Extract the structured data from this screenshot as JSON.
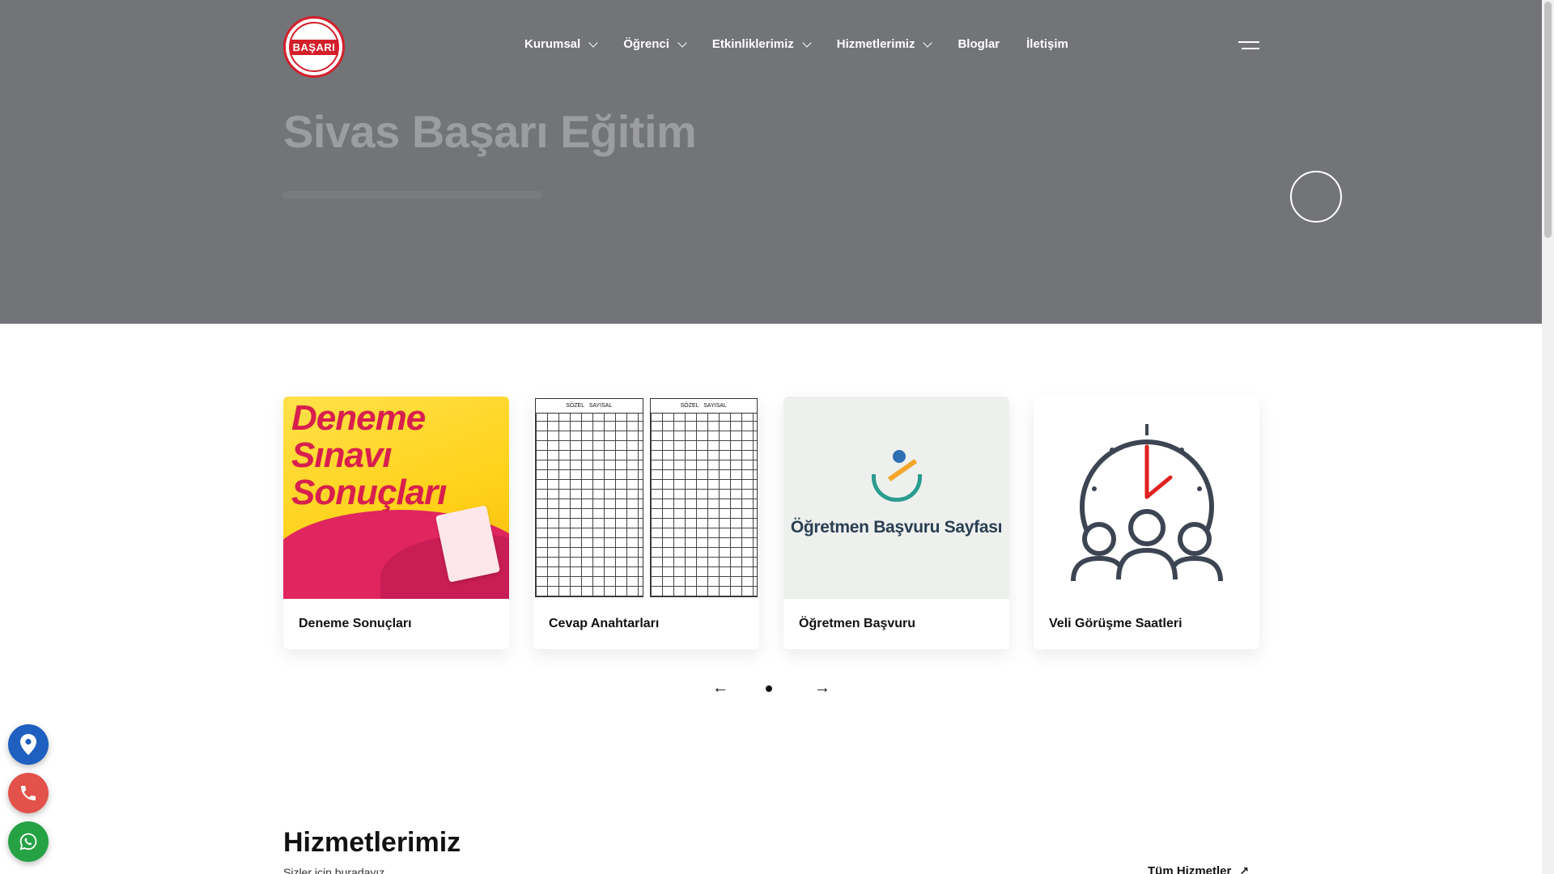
{
  "header": {
    "logo_text": "BAŞARI",
    "nav": [
      {
        "label": "Kurumsal",
        "has_dropdown": true
      },
      {
        "label": "Öğrenci",
        "has_dropdown": true
      },
      {
        "label": "Etkinliklerimiz",
        "has_dropdown": true
      },
      {
        "label": "Hizmetlerimiz",
        "has_dropdown": true
      },
      {
        "label": "Bloglar",
        "has_dropdown": false
      },
      {
        "label": "İletişim",
        "has_dropdown": false
      }
    ],
    "menu_icon": "hamburger-icon"
  },
  "hero": {
    "title": "Sivas Başarı Eğitim",
    "play_icon": "play-circle-icon"
  },
  "cards": [
    {
      "label": "Deneme Sonuçları",
      "image_text": [
        "Deneme",
        "Sınavı",
        "Sonuçları"
      ]
    },
    {
      "label": "Cevap Anahtarları",
      "image_text": [
        "SÖZEL",
        "SAYISAL"
      ]
    },
    {
      "label": "Öğretmen Başvuru",
      "image_text": [
        "Öğretmen Başvuru Sayfası"
      ]
    },
    {
      "label": "Veli Görüşme Saatleri",
      "image_text": []
    }
  ],
  "slider": {
    "prev_icon": "arrow-left-icon",
    "next_icon": "arrow-right-icon",
    "dots": 1,
    "active_dot": 0
  },
  "floating_buttons": [
    {
      "name": "location",
      "icon": "map-pin-icon",
      "color": "#1f5fbf"
    },
    {
      "name": "phone",
      "icon": "phone-icon",
      "color": "#e2524a"
    },
    {
      "name": "whatsapp",
      "icon": "whatsapp-icon",
      "color": "#25a244"
    }
  ],
  "services": {
    "title": "Hizmetlerimiz",
    "subtitle": "Sizler için buradayız",
    "all_link": "Tüm Hizmetler"
  },
  "colors": {
    "hero_bg": "#737478",
    "brand_red": "#d41f2a"
  }
}
